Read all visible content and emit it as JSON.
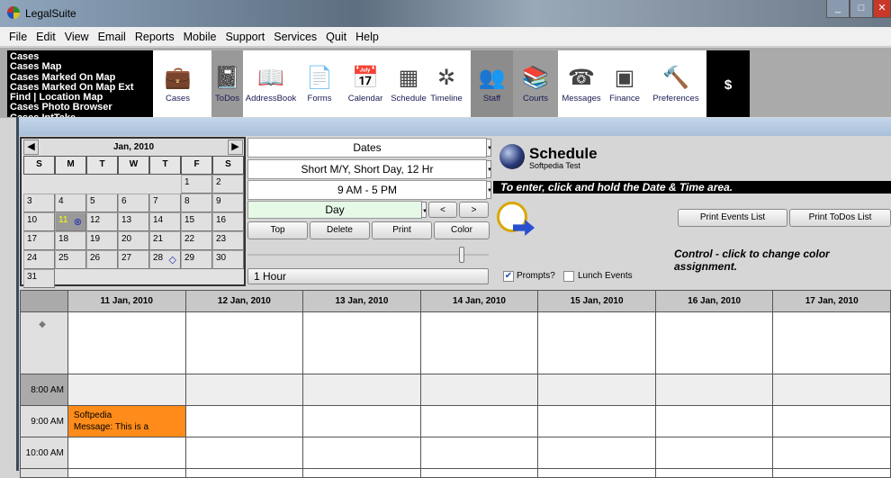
{
  "window": {
    "title": "LegalSuite",
    "controls": [
      "_",
      "□",
      "✕"
    ]
  },
  "menu": [
    "File",
    "Edit",
    "View",
    "Email",
    "Reports",
    "Mobile",
    "Support",
    "Services",
    "Quit",
    "Help"
  ],
  "quick_list": [
    "Cases",
    "Cases Map",
    "Cases Marked On Map",
    "Cases Marked On Map Ext",
    "Find | Location Map",
    "Cases Photo Browser",
    "Cases IntTake"
  ],
  "toolbar": [
    {
      "label": "Cases",
      "icon": "briefcase-icon",
      "glyph": "💼",
      "bg": "#ffffff"
    },
    {
      "label": "ToDos",
      "icon": "notebook-icon",
      "glyph": "📓",
      "bg": "#999999"
    },
    {
      "label": "AddressBook",
      "icon": "address-book-icon",
      "glyph": "📖",
      "bg": "#ffffff"
    },
    {
      "label": "Forms",
      "icon": "forms-icon",
      "glyph": "📄",
      "bg": "#ffffff"
    },
    {
      "label": "Calendar",
      "icon": "calendar-icon",
      "glyph": "📅",
      "bg": "#ffffff"
    },
    {
      "label": "Schedule",
      "icon": "schedule-grid-icon",
      "glyph": "▦",
      "bg": "#ffffff"
    },
    {
      "label": "Timeline",
      "icon": "timeline-icon",
      "glyph": "✲",
      "bg": "#ffffff"
    },
    {
      "label": "Staff",
      "icon": "staff-icon",
      "glyph": "👥",
      "bg": "#8c8c8c"
    },
    {
      "label": "Courts",
      "icon": "books-icon",
      "glyph": "📚",
      "bg": "#9c9c9c"
    },
    {
      "label": "Messages",
      "icon": "messages-icon",
      "glyph": "☎",
      "bg": "#ffffff"
    },
    {
      "label": "Finance",
      "icon": "calculator-icon",
      "glyph": "▣",
      "bg": "#ffffff"
    },
    {
      "label": "Preferences",
      "icon": "tools-icon",
      "glyph": "🔨",
      "bg": "#ffffff"
    }
  ],
  "dollar_label": "$",
  "calendar": {
    "month": "Jan, 2010",
    "weekdays": [
      "S",
      "M",
      "T",
      "W",
      "T",
      "F",
      "S"
    ],
    "lead_blank": 5,
    "days": 31,
    "selected": 11,
    "marks": {
      "11": "⊗",
      "28": "◇"
    }
  },
  "controls": {
    "dates": "Dates",
    "format": "Short M/Y, Short Day, 12  Hr",
    "hours": "9 AM - 5 PM",
    "view": "Day",
    "prev": "<",
    "next": ">",
    "top": "Top",
    "delete": "Delete",
    "print": "Print",
    "color": "Color",
    "interval": "1 Hour",
    "prompts_label": "Prompts?",
    "prompts_checked": true,
    "lunch_label": "Lunch Events",
    "lunch_checked": false
  },
  "schedule": {
    "title": "Schedule",
    "subtitle": "Softpedia Test",
    "banner": "To enter, click and hold the Date & Time area.",
    "print_events": "Print Events List",
    "print_todos": "Print ToDos List",
    "control_hint": "Control - click to change color assignment."
  },
  "grid": {
    "days": [
      "11 Jan, 2010",
      "12 Jan, 2010",
      "13 Jan, 2010",
      "14 Jan, 2010",
      "15 Jan, 2010",
      "16 Jan, 2010",
      "17 Jan, 2010"
    ],
    "allday_marker": "◆",
    "times": [
      "8:00 AM",
      "9:00 AM",
      "10:00 AM"
    ],
    "event": {
      "title": "Softpedia",
      "message": "Message:  This is a",
      "color": "#ff8c1a"
    }
  }
}
